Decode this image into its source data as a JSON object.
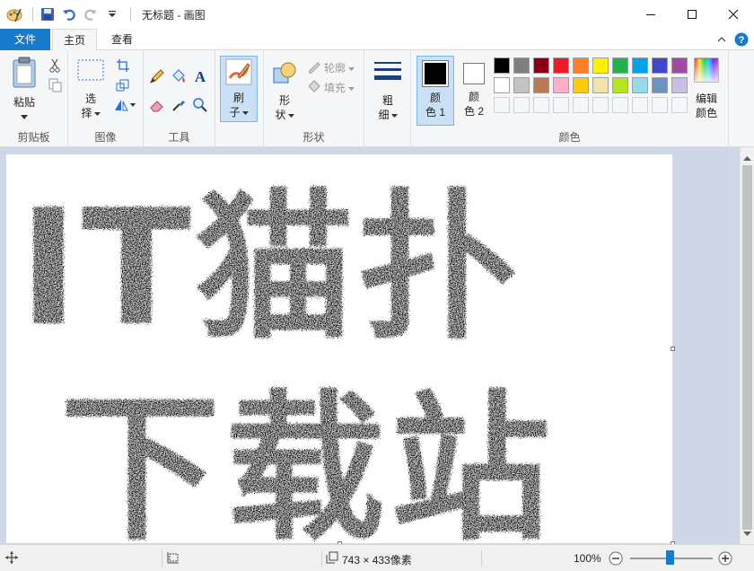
{
  "window": {
    "title": "无标题 - 画图"
  },
  "tabs": {
    "file": "文件",
    "home": "主页",
    "view": "查看"
  },
  "clipboard": {
    "paste": "粘贴",
    "group": "剪贴板"
  },
  "image": {
    "select_line1": "选",
    "select_line2": "择",
    "group": "图像"
  },
  "tools": {
    "group": "工具"
  },
  "brush": {
    "line1": "刷",
    "line2": "子"
  },
  "shapes": {
    "line1": "形",
    "line2": "状",
    "outline": "轮廓",
    "fill": "填充",
    "group": "形状"
  },
  "size": {
    "line1": "粗",
    "line2": "细"
  },
  "colors": {
    "color1_line1": "颜",
    "color1_line2": "色 1",
    "color2_line1": "颜",
    "color2_line2": "色 2",
    "edit_line1": "编辑",
    "edit_line2": "颜色",
    "group": "颜色",
    "row1": [
      "#000000",
      "#7f7f7f",
      "#880015",
      "#ed1c24",
      "#ff7f27",
      "#fff200",
      "#22b14c",
      "#00a2e8",
      "#3f48cc",
      "#a349a4"
    ],
    "row2": [
      "#ffffff",
      "#c3c3c3",
      "#b97a57",
      "#ffaec9",
      "#ffc90e",
      "#efe4b0",
      "#b5e61d",
      "#99d9ea",
      "#7092be",
      "#c8bfe7"
    ],
    "color1": "#000000",
    "color2": "#ffffff"
  },
  "canvas_text": {
    "line1": "IT猫扑",
    "line2": "下载站"
  },
  "status": {
    "dimensions": "743 × 433像素",
    "zoom": "100%"
  }
}
